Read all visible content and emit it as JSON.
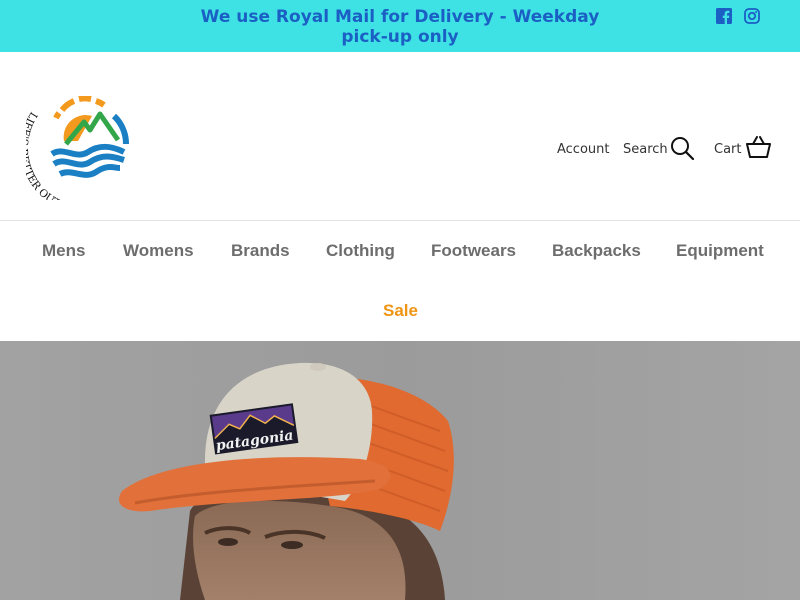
{
  "announcement": {
    "text_line1": "We use Royal Mail for Delivery - Weekday",
    "text_line2": "pick-up only"
  },
  "social": [
    {
      "icon": "facebook-icon"
    },
    {
      "icon": "instagram-icon"
    }
  ],
  "logo": {
    "text": "LIFE'S BETTER OUTDOORS",
    "icon": "mountain-sun-logo"
  },
  "header": {
    "account_label": "Account",
    "search_label": "Search",
    "cart_label": "Cart"
  },
  "nav": {
    "items": [
      "Mens",
      "Womens",
      "Brands",
      "Clothing",
      "Footwears",
      "Backpacks",
      "Equipment"
    ],
    "sale_label": "Sale"
  },
  "hero": {
    "cap_patch_text": "patagonia"
  },
  "colors": {
    "announcement_bg": "#3ee2e4",
    "announcement_text": "#1b5fc4",
    "nav_text": "#6d6d6d",
    "sale_text": "#f09413",
    "hero_bg": "#9c9c9c"
  }
}
